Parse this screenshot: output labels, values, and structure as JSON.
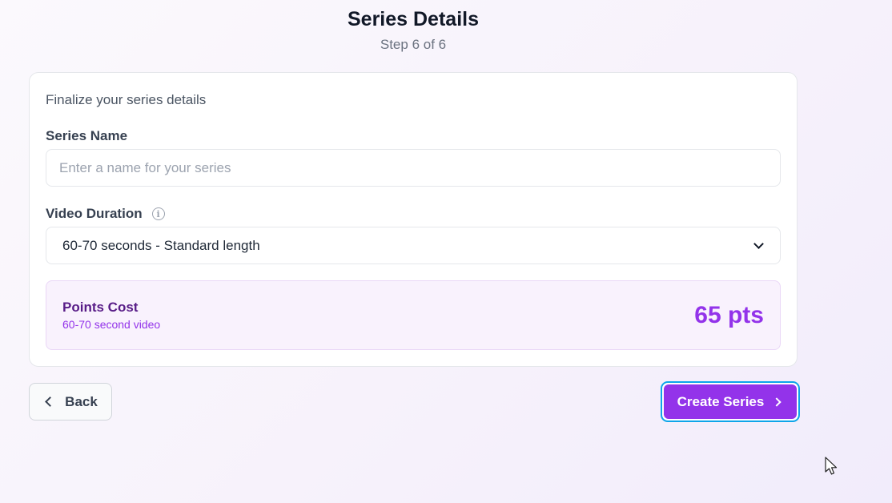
{
  "header": {
    "title": "Series Details",
    "step": "Step 6 of 6"
  },
  "card": {
    "description": "Finalize your series details",
    "series_name": {
      "label": "Series Name",
      "value": "",
      "placeholder": "Enter a name for your series"
    },
    "video_duration": {
      "label": "Video Duration",
      "selected": "60-70 seconds - Standard length",
      "icon": "info-icon"
    },
    "points_cost": {
      "title": "Points Cost",
      "subtitle": "60-70 second video",
      "value": "65 pts"
    }
  },
  "footer": {
    "back_label": "Back",
    "create_label": "Create Series"
  },
  "colors": {
    "accent": "#9333ea",
    "focus_ring": "#0ea5e9",
    "cost_bg": "#f9f2fd"
  }
}
